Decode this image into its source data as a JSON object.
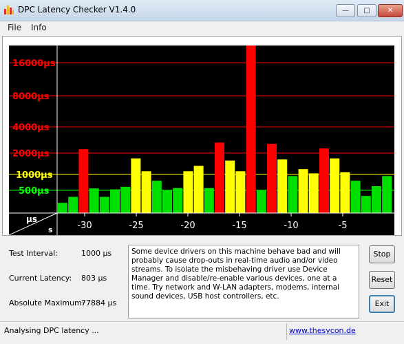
{
  "window": {
    "title": "DPC Latency Checker V1.4.0",
    "controls": {
      "minimize": "—",
      "maximize": "□",
      "close": "✕"
    }
  },
  "menu": {
    "items": [
      "File",
      "Info"
    ]
  },
  "chart_data": {
    "type": "bar",
    "ylabels": [
      "16000µs",
      "8000µs",
      "4000µs",
      "2000µs",
      "1000µs",
      "500µs"
    ],
    "ylabel_colors": [
      "#ff0000",
      "#ff0000",
      "#ff0000",
      "#ff0000",
      "#ffff00",
      "#00ff00"
    ],
    "unit_top": "µs",
    "unit_bottom": "s",
    "xticks": [
      "-30",
      "-25",
      "-20",
      "-15",
      "-10",
      "-5"
    ],
    "values_us": [
      230,
      360,
      2300,
      560,
      360,
      530,
      610,
      1750,
      1150,
      800,
      500,
      570,
      1150,
      1400,
      570,
      2800,
      1650,
      1150,
      77884,
      500,
      2700,
      1700,
      950,
      1250,
      1050,
      2350,
      1750,
      1100,
      800,
      380,
      630,
      950
    ],
    "colors": {
      "green": "#00e000",
      "yellow": "#ffff00",
      "red": "#ff0000",
      "background": "#000000"
    }
  },
  "info": {
    "test_interval_label": "Test Interval:",
    "test_interval_value": "1000 µs",
    "current_latency_label": "Current Latency:",
    "current_latency_value": "803 µs",
    "absolute_max_label": "Absolute Maximum:",
    "absolute_max_value": "77884 µs"
  },
  "message": "Some device drivers on this machine behave bad and will probably cause drop-outs in real-time audio and/or video streams. To isolate the misbehaving driver use Device Manager and disable/re-enable various devices, one at a time. Try network and W-LAN adapters, modems, internal sound devices, USB host controllers, etc.",
  "buttons": {
    "stop": "Stop",
    "reset": "Reset",
    "exit": "Exit"
  },
  "status": {
    "text": "Analysing DPC latency ...",
    "link": "www.thesycon.de"
  }
}
